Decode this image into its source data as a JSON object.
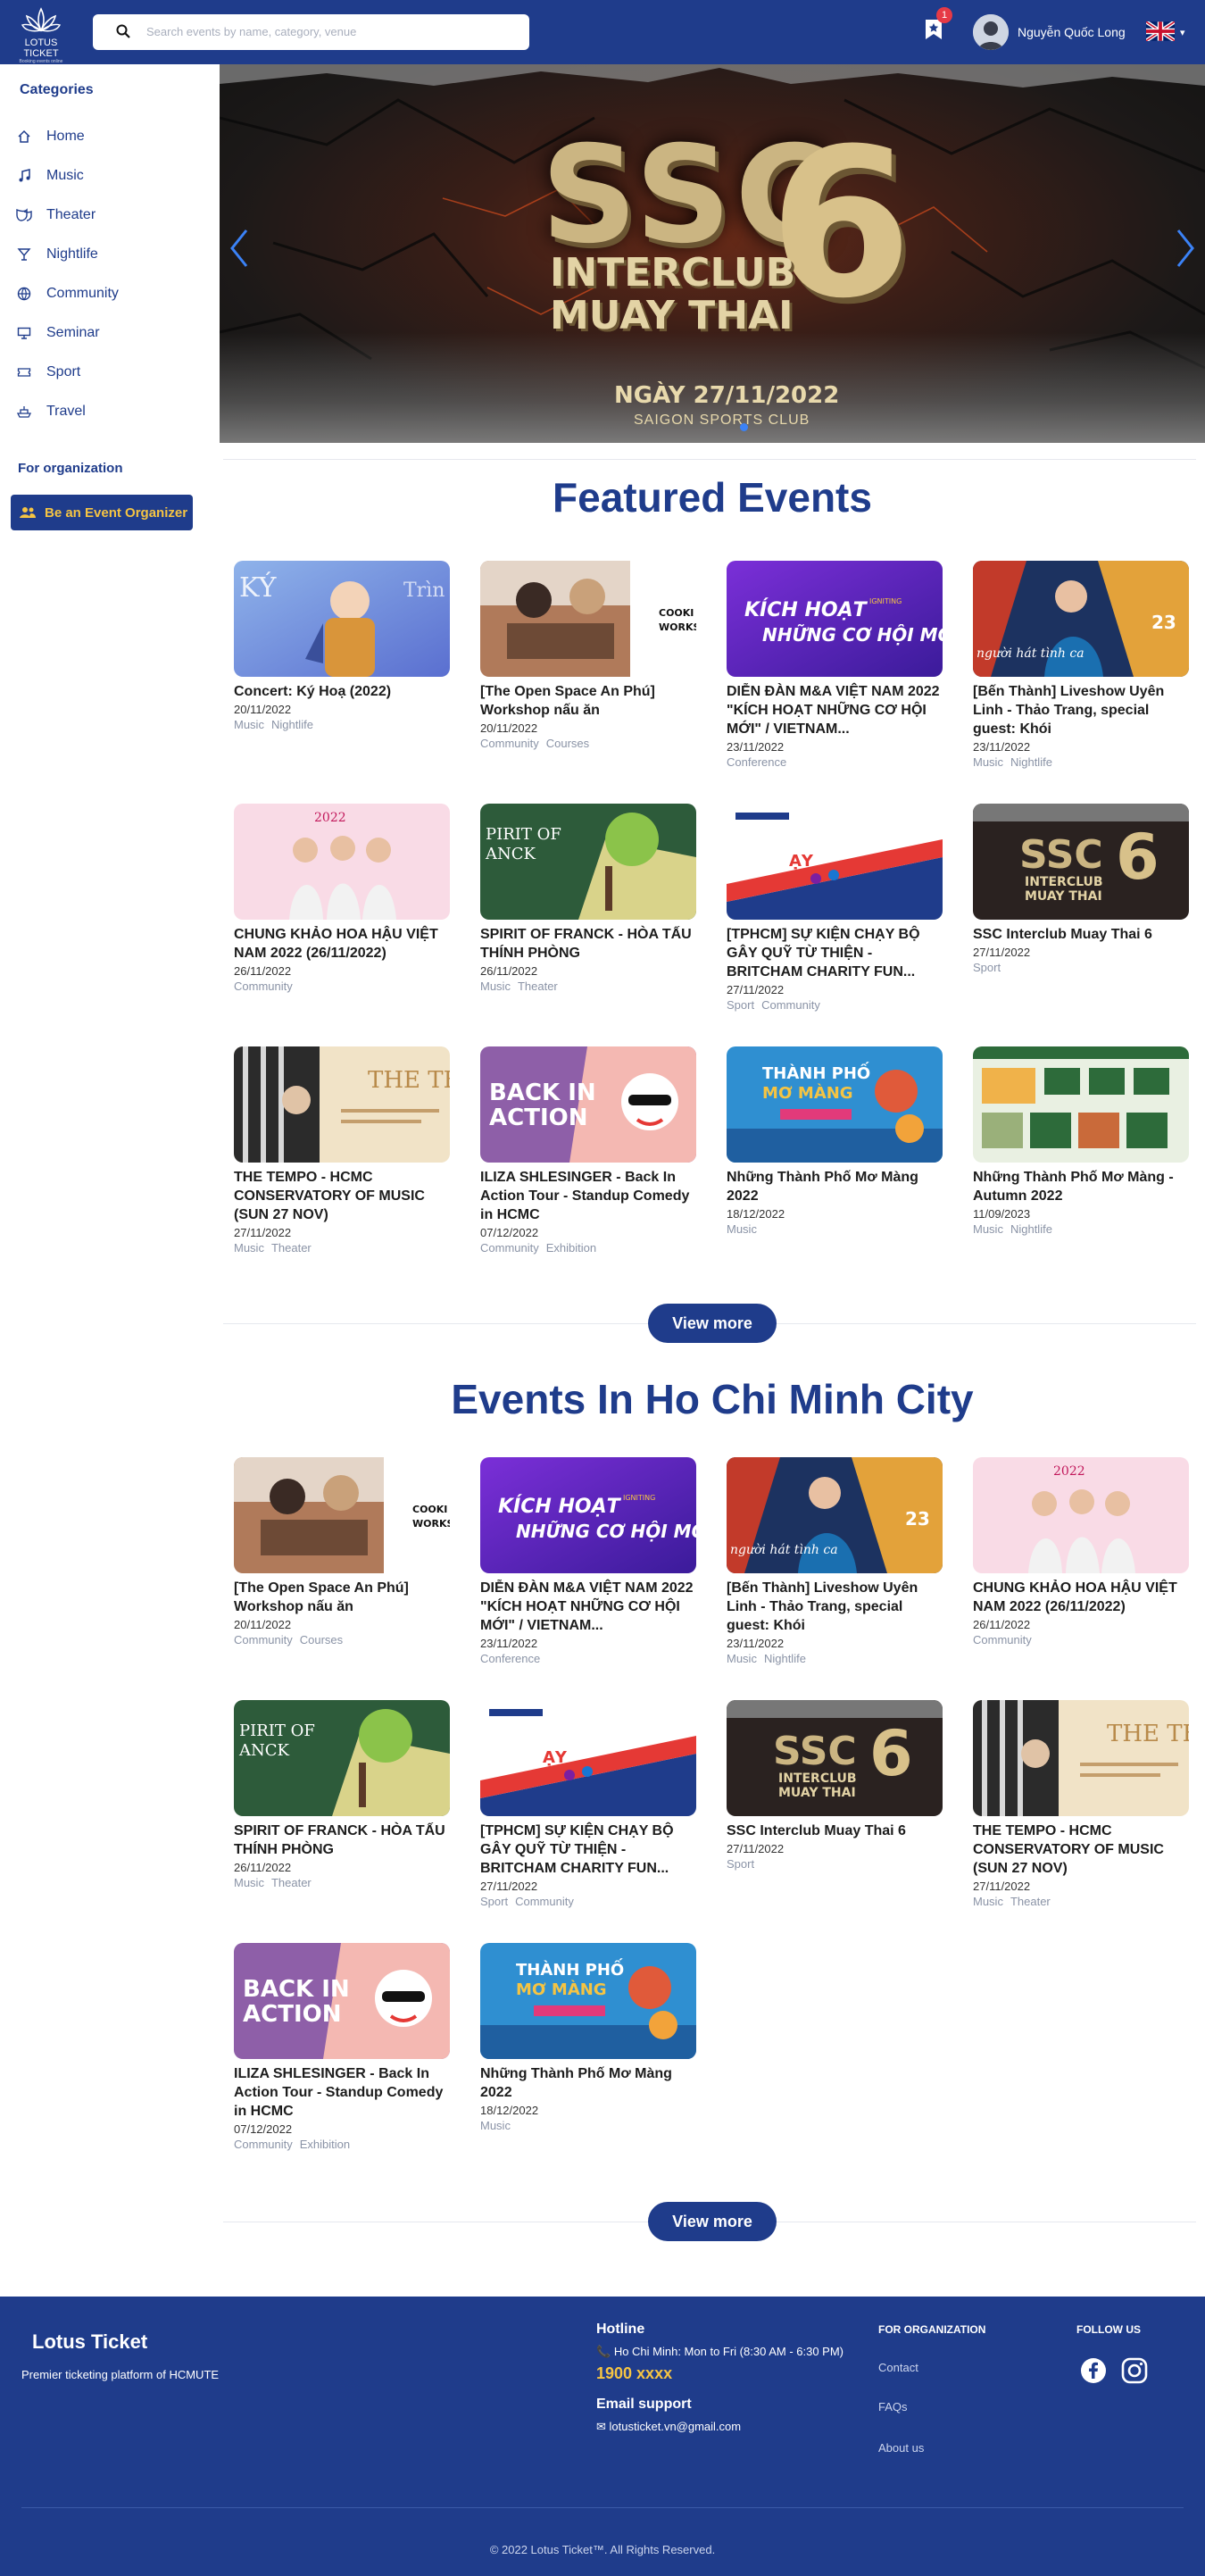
{
  "header": {
    "logo_line1": "LOTUS TICKET",
    "logo_line2": "Booking events online",
    "search_placeholder": "Search events by name, category, venue",
    "notification_count": "1",
    "user_name": "Nguyễn Quốc Long"
  },
  "sidebar": {
    "title": "Categories",
    "items": [
      {
        "label": "Home",
        "icon": "home-icon"
      },
      {
        "label": "Music",
        "icon": "music-note-icon"
      },
      {
        "label": "Theater",
        "icon": "theater-mask-icon"
      },
      {
        "label": "Nightlife",
        "icon": "cocktail-icon"
      },
      {
        "label": "Community",
        "icon": "globe-icon"
      },
      {
        "label": "Seminar",
        "icon": "presentation-icon"
      },
      {
        "label": "Sport",
        "icon": "ticket-icon"
      },
      {
        "label": "Travel",
        "icon": "ship-icon"
      }
    ],
    "org_title": "For organization",
    "org_button": "Be an Event Organizer"
  },
  "banner": {
    "title_main": "SSC",
    "title_number": "6",
    "subtitle_1": "INTERCLUB",
    "subtitle_2": "MUAY THAI",
    "date": "NGÀY 27/11/2022",
    "venue": "SAIGON SPORTS CLUB"
  },
  "featured": {
    "title": "Featured Events",
    "view_more": "View more",
    "events": [
      {
        "title": "Concert: Ký Hoạ (2022)",
        "date": "20/11/2022",
        "tags": [
          "Music",
          "Nightlife"
        ],
        "art": "kyhoa"
      },
      {
        "title": "[The Open Space An Phú] Workshop nấu ăn",
        "date": "20/11/2022",
        "tags": [
          "Community",
          "Courses"
        ],
        "art": "cooking"
      },
      {
        "title": "DIỄN ĐÀN M&A VIỆT NAM 2022 \"KÍCH HOẠT NHỮNG CƠ HỘI MỚI\" / VIETNAM...",
        "date": "23/11/2022",
        "tags": [
          "Conference"
        ],
        "art": "kichhoat"
      },
      {
        "title": "[Bến Thành] Liveshow Uyên Linh - Thảo Trang, special guest: Khói",
        "date": "23/11/2022",
        "tags": [
          "Music",
          "Nightlife"
        ],
        "art": "uyenlinh"
      },
      {
        "title": "CHUNG KHẢO HOA HẬU VIỆT NAM 2022 (26/11/2022)",
        "date": "26/11/2022",
        "tags": [
          "Community"
        ],
        "art": "hoahau"
      },
      {
        "title": "SPIRIT OF FRANCK - HÒA TẤU THÍNH PHÒNG",
        "date": "26/11/2022",
        "tags": [
          "Music",
          "Theater"
        ],
        "art": "franck"
      },
      {
        "title": "[TPHCM] SỰ KIỆN CHẠY BỘ GÂY QUỸ TỪ THIỆN - BRITCHAM CHARITY FUN...",
        "date": "27/11/2022",
        "tags": [
          "Sport",
          "Community"
        ],
        "art": "run"
      },
      {
        "title": "SSC Interclub Muay Thai 6",
        "date": "27/11/2022",
        "tags": [
          "Sport"
        ],
        "art": "ssc"
      },
      {
        "title": "THE TEMPO - HCMC CONSERVATORY OF MUSIC (SUN 27 NOV)",
        "date": "27/11/2022",
        "tags": [
          "Music",
          "Theater"
        ],
        "art": "tempo"
      },
      {
        "title": "ILIZA SHLESINGER - Back In Action Tour - Standup Comedy in HCMC",
        "date": "07/12/2022",
        "tags": [
          "Community",
          "Exhibition"
        ],
        "art": "iliza"
      },
      {
        "title": "Những Thành Phố Mơ Màng 2022",
        "date": "18/12/2022",
        "tags": [
          "Music"
        ],
        "art": "thanhpho"
      },
      {
        "title": "Những Thành Phố Mơ Màng - Autumn 2022",
        "date": "11/09/2023",
        "tags": [
          "Music",
          "Nightlife"
        ],
        "art": "autumn"
      }
    ]
  },
  "hcm": {
    "title": "Events In Ho Chi Minh City",
    "view_more": "View more",
    "events": [
      {
        "title": "[The Open Space An Phú] Workshop nấu ăn",
        "date": "20/11/2022",
        "tags": [
          "Community",
          "Courses"
        ],
        "art": "cooking"
      },
      {
        "title": "DIỄN ĐÀN M&A VIỆT NAM 2022 \"KÍCH HOẠT NHỮNG CƠ HỘI MỚI\" / VIETNAM...",
        "date": "23/11/2022",
        "tags": [
          "Conference"
        ],
        "art": "kichhoat"
      },
      {
        "title": "[Bến Thành] Liveshow Uyên Linh - Thảo Trang, special guest: Khói",
        "date": "23/11/2022",
        "tags": [
          "Music",
          "Nightlife"
        ],
        "art": "uyenlinh"
      },
      {
        "title": "CHUNG KHẢO HOA HẬU VIỆT NAM 2022 (26/11/2022)",
        "date": "26/11/2022",
        "tags": [
          "Community"
        ],
        "art": "hoahau"
      },
      {
        "title": "SPIRIT OF FRANCK - HÒA TẤU THÍNH PHÒNG",
        "date": "26/11/2022",
        "tags": [
          "Music",
          "Theater"
        ],
        "art": "franck"
      },
      {
        "title": "[TPHCM] SỰ KIỆN CHẠY BỘ GÂY QUỸ TỪ THIỆN - BRITCHAM CHARITY FUN...",
        "date": "27/11/2022",
        "tags": [
          "Sport",
          "Community"
        ],
        "art": "run"
      },
      {
        "title": "SSC Interclub Muay Thai 6",
        "date": "27/11/2022",
        "tags": [
          "Sport"
        ],
        "art": "ssc"
      },
      {
        "title": "THE TEMPO - HCMC CONSERVATORY OF MUSIC (SUN 27 NOV)",
        "date": "27/11/2022",
        "tags": [
          "Music",
          "Theater"
        ],
        "art": "tempo"
      },
      {
        "title": "ILIZA SHLESINGER - Back In Action Tour - Standup Comedy in HCMC",
        "date": "07/12/2022",
        "tags": [
          "Community",
          "Exhibition"
        ],
        "art": "iliza"
      },
      {
        "title": "Những Thành Phố Mơ Màng 2022",
        "date": "18/12/2022",
        "tags": [
          "Music"
        ],
        "art": "thanhpho"
      }
    ]
  },
  "footer": {
    "brand": "Lotus Ticket",
    "tagline": "Premier ticketing platform of HCMUTE",
    "hotline_title": "Hotline",
    "hotline_hours": "Ho Chi Minh: Mon to Fri (8:30 AM - 6:30 PM)",
    "hotline_number": "1900 xxxx",
    "email_title": "Email support",
    "email": "lotusticket.vn@gmail.com",
    "org_title": "FOR ORGANIZATION",
    "links": [
      "Contact",
      "FAQs",
      "About us"
    ],
    "follow_title": "FOLLOW US",
    "copyright": "© 2022 Lotus Ticket™. All Rights Reserved."
  },
  "colors": {
    "primary": "#1f3c8b",
    "accent_yellow": "#f5c443",
    "tag_gray": "#8a93a6",
    "carousel_arrow": "#3b82f6"
  }
}
